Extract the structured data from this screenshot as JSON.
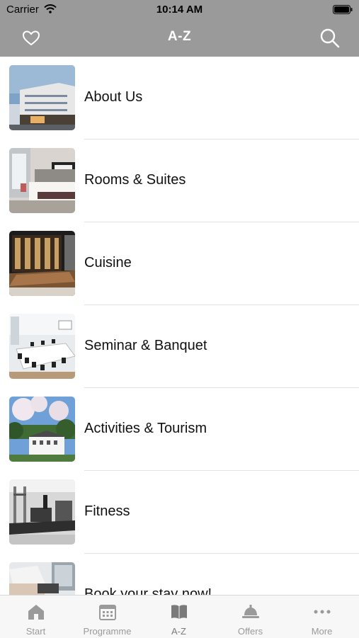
{
  "status_bar": {
    "carrier": "Carrier",
    "time": "10:14 AM"
  },
  "nav": {
    "title": "A-Z"
  },
  "items": [
    {
      "label": "About Us",
      "image": "hotel-exterior"
    },
    {
      "label": "Rooms & Suites",
      "image": "hotel-room"
    },
    {
      "label": "Cuisine",
      "image": "restaurant-wine-wall"
    },
    {
      "label": "Seminar & Banquet",
      "image": "conference-room"
    },
    {
      "label": "Activities & Tourism",
      "image": "blossom-villa"
    },
    {
      "label": "Fitness",
      "image": "gym"
    },
    {
      "label": "Book your stay now!",
      "image": "booking-desk"
    }
  ],
  "tabs": [
    {
      "label": "Start",
      "icon": "home-icon"
    },
    {
      "label": "Programme",
      "icon": "calendar-icon"
    },
    {
      "label": "A-Z",
      "icon": "book-icon",
      "active": true
    },
    {
      "label": "Offers",
      "icon": "bell-icon"
    },
    {
      "label": "More",
      "icon": "more-icon"
    }
  ],
  "colors": {
    "bar": "#9a9a9a",
    "tab_inactive": "#9a9a9a",
    "tab_active": "#7a7a7a"
  }
}
